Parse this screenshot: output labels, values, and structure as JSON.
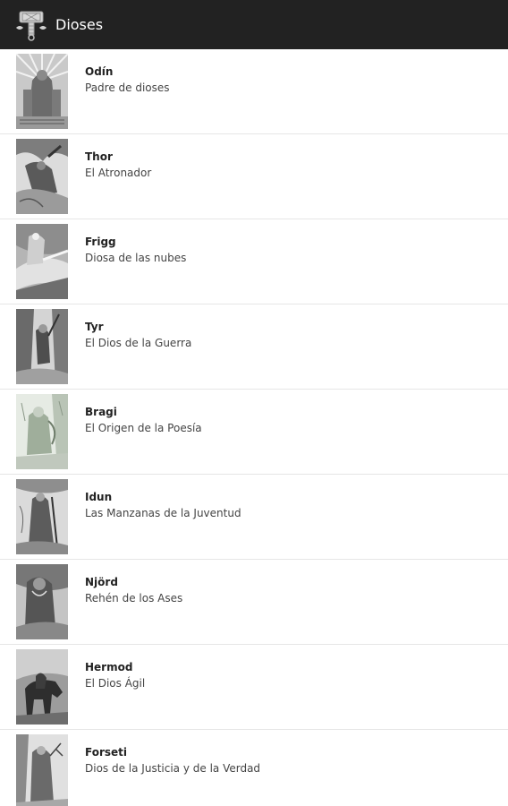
{
  "action_bar": {
    "title": "Dioses",
    "logo_icon": "mjolnir-hammer-icon"
  },
  "colors": {
    "action_bar_background": "#222222",
    "title_text": "#ffffff",
    "divider": "#e6e6e6"
  },
  "gods": [
    {
      "name": "Odín",
      "description": "Padre de dioses",
      "image": "odin-engraving"
    },
    {
      "name": "Thor",
      "description": "El Atronador",
      "image": "thor-engraving"
    },
    {
      "name": "Frigg",
      "description": "Diosa de las nubes",
      "image": "frigg-engraving"
    },
    {
      "name": "Tyr",
      "description": "El Dios de la Guerra",
      "image": "tyr-engraving"
    },
    {
      "name": "Bragi",
      "description": "El Origen de la Poesía",
      "image": "bragi-engraving"
    },
    {
      "name": "Idun",
      "description": "Las Manzanas de la Juventud",
      "image": "idun-engraving"
    },
    {
      "name": "Njörd",
      "description": "Rehén de los Ases",
      "image": "njord-engraving"
    },
    {
      "name": "Hermod",
      "description": "El Dios Ágil",
      "image": "hermod-engraving"
    },
    {
      "name": "Forseti",
      "description": "Dios de la Justicia y de la Verdad",
      "image": "forseti-engraving"
    }
  ]
}
